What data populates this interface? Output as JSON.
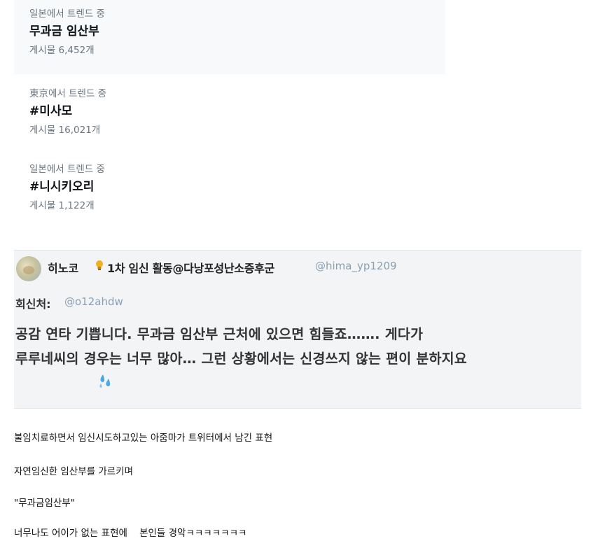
{
  "trends": [
    {
      "location": "일본에서 트렌드 중",
      "name": "무과금 임산부",
      "posts": "게시물 6,452개"
    },
    {
      "location": "東京에서 트렌드 중",
      "name": "#미사모",
      "posts": "게시물 16,021개"
    },
    {
      "location": "일본에서 트렌드 중",
      "name": "#니시키오리",
      "posts": "게시물 1,122개"
    }
  ],
  "tweet": {
    "display_name": "히노코",
    "bio_tag": "1차 임신 활동@다낭포성난소증후군",
    "handle": "@hima_yp1209",
    "reply_label": "회신처:",
    "reply_handle": "@o12ahdw",
    "body_lines": [
      "공감 연타 기쁩니다. 무과금 임산부 근처에 있으면 힘들죠……. 게다가",
      "루루네씨의 경우는 너무 많아… 그런 상황에서는 신경쓰지 않는 편이 분하지요"
    ],
    "icons": {
      "bulb": "lightbulb-icon",
      "drops": "sweat-drops-icon",
      "more": "more-options-icon"
    },
    "colors": {
      "handle": "#8aa0b2",
      "card_bg": "#f2f4f6"
    }
  },
  "captions": [
    "불임치료하면서 임신시도하고있는 아줌마가 트위터에서 남긴 표현",
    "자연임신한 임산부를 가르키며",
    "\"무과금임산부\"",
    "너무나도 어이가 없는 표현에    본인들 경악ㅋㅋㅋㅋㅋㅋㅋ"
  ]
}
